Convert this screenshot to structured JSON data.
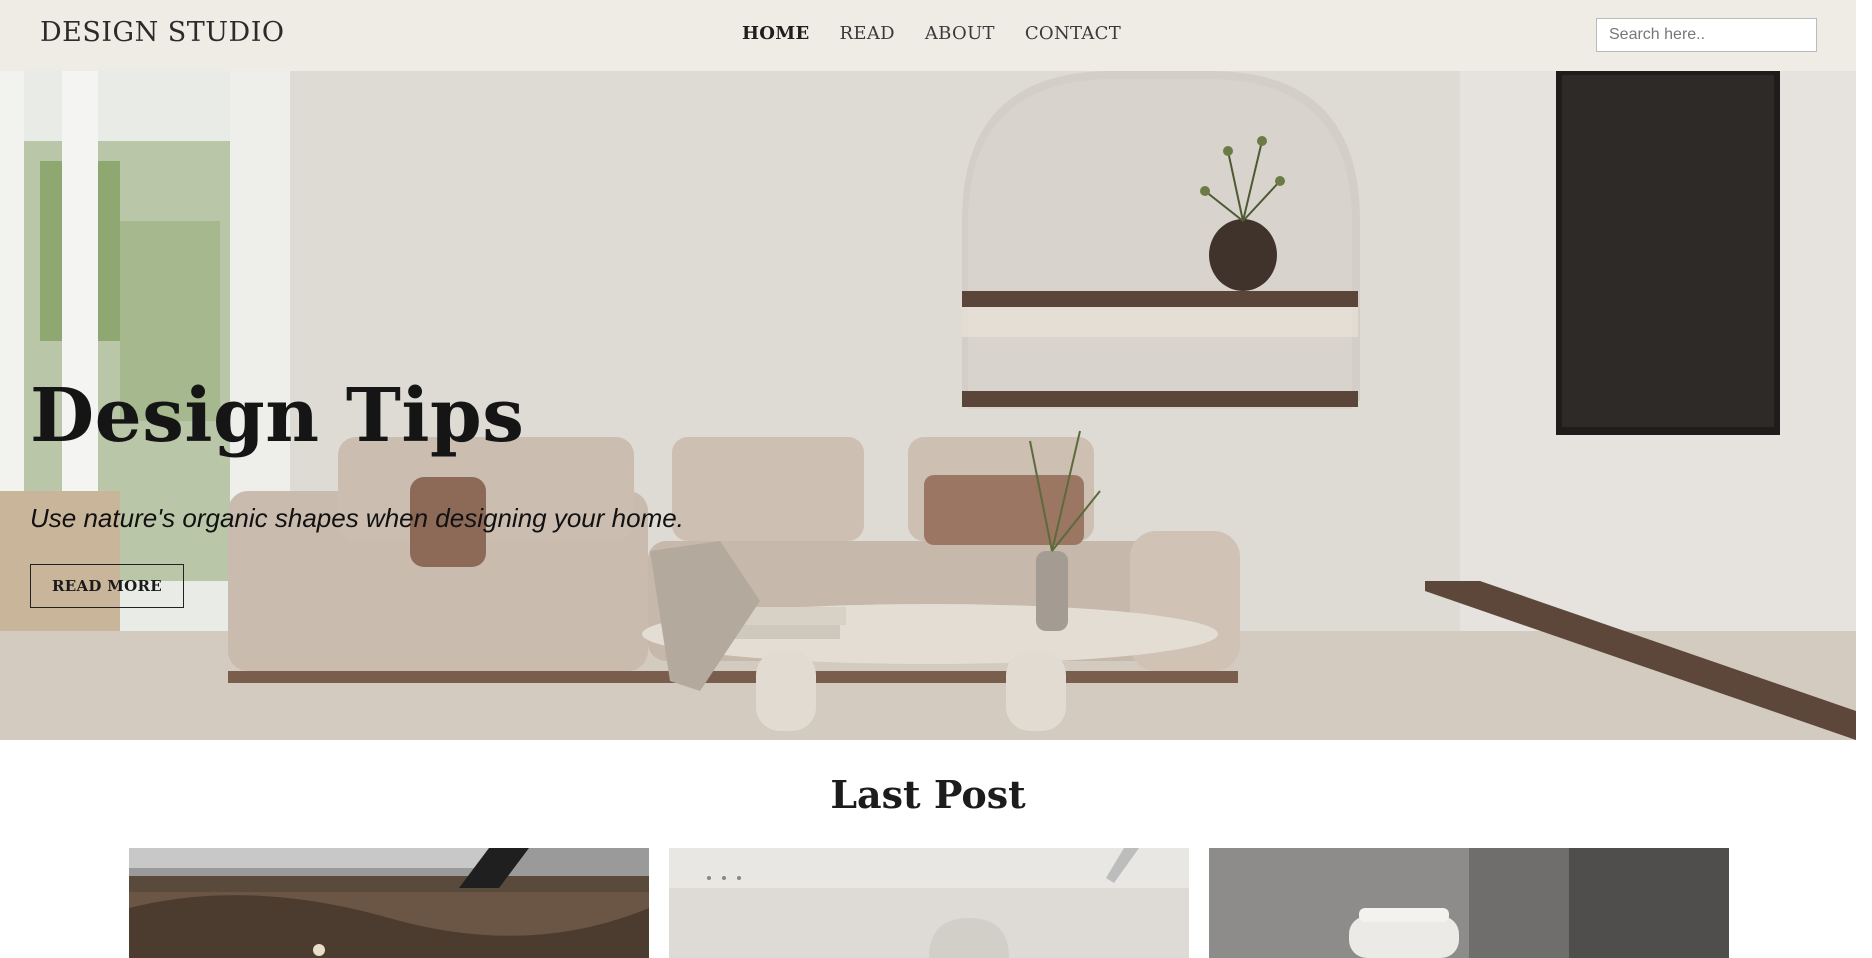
{
  "header": {
    "brand": "DESIGN STUDIO",
    "nav": [
      {
        "label": "HOME",
        "active": true
      },
      {
        "label": "READ",
        "active": false
      },
      {
        "label": "ABOUT",
        "active": false
      },
      {
        "label": "CONTACT",
        "active": false
      }
    ],
    "search_placeholder": "Search here.."
  },
  "hero": {
    "title": "Design Tips",
    "subtitle": "Use nature's organic shapes when designing your home.",
    "button_label": "READ MORE"
  },
  "last_post": {
    "title": "Last Post"
  },
  "colors": {
    "topbar": "#efece6",
    "wall": "#dcd8d2",
    "sofa": "#c6b7aa",
    "shelf": "#5a4538",
    "tv": "#2a2826"
  }
}
